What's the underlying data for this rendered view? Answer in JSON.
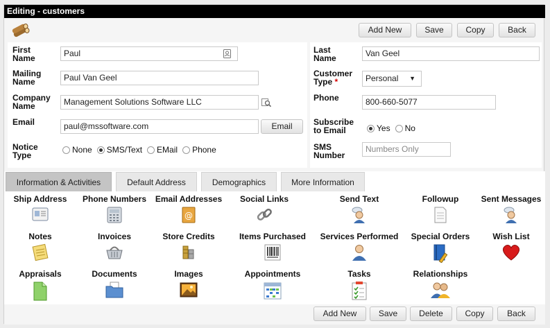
{
  "window": {
    "title": "Editing - customers"
  },
  "toolbar_top": {
    "add_new": "Add New",
    "save": "Save",
    "copy": "Copy",
    "back": "Back"
  },
  "form": {
    "first_name": {
      "label": "First Name",
      "value": "Paul"
    },
    "last_name": {
      "label": "Last Name",
      "value": "Van Geel"
    },
    "mailing_name": {
      "label": "Mailing Name",
      "value": "Paul Van Geel"
    },
    "customer_type": {
      "label": "Customer Type",
      "required_mark": "*",
      "value": "Personal"
    },
    "company_name": {
      "label": "Company Name",
      "value": "Management Solutions Software LLC"
    },
    "phone": {
      "label": "Phone",
      "value": "800-660-5077"
    },
    "email": {
      "label": "Email",
      "value": "paul@mssoftware.com",
      "button": "Email"
    },
    "subscribe": {
      "label": "Subscribe to Email",
      "options": [
        "Yes",
        "No"
      ],
      "selected": "Yes"
    },
    "notice_type": {
      "label": "Notice Type",
      "options": [
        "None",
        "SMS/Text",
        "EMail",
        "Phone"
      ],
      "selected": "SMS/Text"
    },
    "sms_number": {
      "label": "SMS Number",
      "placeholder": "Numbers Only"
    }
  },
  "tabs": [
    {
      "label": "Information & Activities",
      "active": true
    },
    {
      "label": "Default Address",
      "active": false
    },
    {
      "label": "Demographics",
      "active": false
    },
    {
      "label": "More Information",
      "active": false
    }
  ],
  "activities": [
    {
      "label": "Ship Address",
      "icon": "address-card-icon"
    },
    {
      "label": "Phone Numbers",
      "icon": "phone-icon"
    },
    {
      "label": "Email Addresses",
      "icon": "address-book-icon"
    },
    {
      "label": "Social Links",
      "icon": "chain-link-icon"
    },
    {
      "label": "Send Text",
      "icon": "person-chat-icon"
    },
    {
      "label": "Followup",
      "icon": "document-icon"
    },
    {
      "label": "Sent Messages",
      "icon": "person-chat-icon"
    },
    {
      "label": "Notes",
      "icon": "notepad-icon"
    },
    {
      "label": "Invoices",
      "icon": "basket-icon"
    },
    {
      "label": "Store Credits",
      "icon": "coins-icon"
    },
    {
      "label": "Items Purchased",
      "icon": "barcode-icon"
    },
    {
      "label": "Services Performed",
      "icon": "person-icon"
    },
    {
      "label": "Special Orders",
      "icon": "book-pencil-icon"
    },
    {
      "label": "Wish List",
      "icon": "heart-icon"
    },
    {
      "label": "Appraisals",
      "icon": "green-document-icon"
    },
    {
      "label": "Documents",
      "icon": "folder-icon"
    },
    {
      "label": "Images",
      "icon": "picture-icon"
    },
    {
      "label": "Appointments",
      "icon": "calendar-icon"
    },
    {
      "label": "Tasks",
      "icon": "checklist-icon"
    },
    {
      "label": "Relationships",
      "icon": "people-icon"
    }
  ],
  "toolbar_bottom": {
    "add_new": "Add New",
    "save": "Save",
    "delete": "Delete",
    "copy": "Copy",
    "back": "Back"
  },
  "colors": {
    "title_bar": "#000000",
    "active_tab": "#c4c4c4",
    "heart": "#d81b1b"
  }
}
